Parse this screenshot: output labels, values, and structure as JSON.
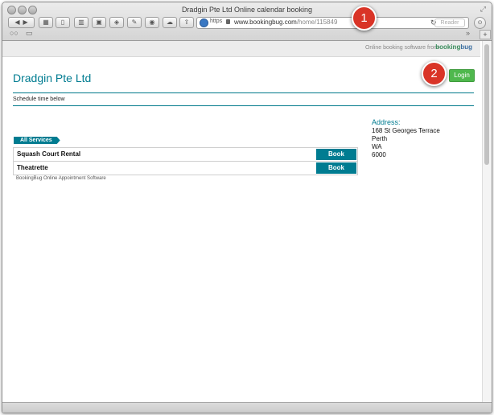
{
  "window": {
    "title": "Dradgin Pte Ltd Online calendar booking",
    "fullscreen_icon": "expand-arrows-icon"
  },
  "toolbar": {
    "back_icon": "back-arrow-icon",
    "forward_icon": "forward-arrow-icon",
    "reload_icon": "reload-icon",
    "reader_label": "Reader",
    "overflow_label": "»",
    "new_tab_label": "+"
  },
  "address_bar": {
    "scheme": "https",
    "host": "www.bookingbug.com",
    "path": "/home/115849"
  },
  "callouts": [
    "1",
    "2"
  ],
  "page": {
    "strip_text": "Online booking software from",
    "logo_prefix": "booking",
    "logo_suffix": "bug",
    "company_name": "Dradgin Pte Ltd",
    "login_label": "Login",
    "schedule_text": "Schedule time below",
    "services_tab": "All Services",
    "services": [
      {
        "name": "Squash Court Rental",
        "action": "Book"
      },
      {
        "name": "Theatrette",
        "action": "Book"
      }
    ],
    "footer_note": "BookingBug Online Appointment Software",
    "address": {
      "label": "Address:",
      "lines": [
        "168 St Georges Terrace",
        "Perth",
        "WA",
        "6000"
      ]
    }
  },
  "colors": {
    "brand_teal": "#007c91",
    "login_green": "#4fb84d",
    "callout_red": "#d93427"
  }
}
